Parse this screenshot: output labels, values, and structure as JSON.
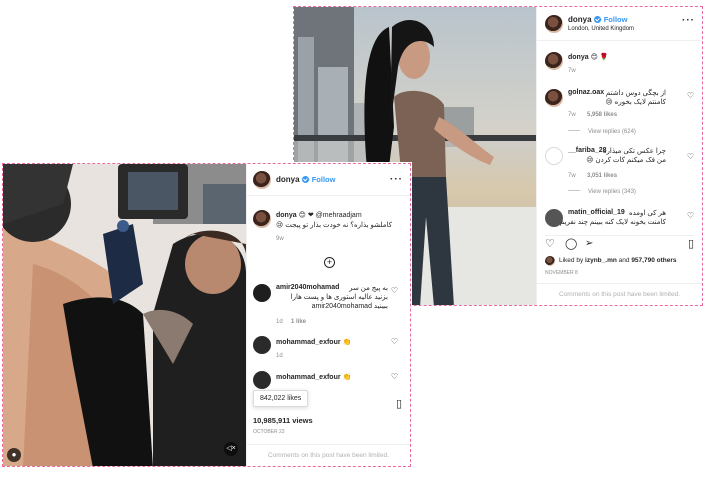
{
  "postB": {
    "username": "donya",
    "follow_label": "Follow",
    "location": "London, United Kingdom",
    "caption_user": "donya",
    "caption_emoji": "😊 🌹",
    "caption_time": "7w",
    "comments": [
      {
        "user": "golnaz.oax",
        "text_line1": "از بچگی دوس داشتم",
        "text_line2": "کامنتم لایک بخوره 😢",
        "time": "7w",
        "likes": "5,958 likes",
        "replies": "View replies (624)"
      },
      {
        "user": "__fariba_28",
        "text_line1": "چرا عکس تکی میذاره",
        "text_line2": "من فک میکنم کات کردن 😢",
        "time": "7w",
        "likes": "3,051 likes",
        "replies": "View replies (343)"
      },
      {
        "user": "matin_official_19",
        "text_line1": "هر کی اومده",
        "text_line2": "کامنت بخونه لایک کنه ببینم چند نفریم",
        "time": "",
        "likes": "",
        "replies": ""
      }
    ],
    "liked_by_prefix": "Liked by",
    "liked_by_user": "izynb_.mn",
    "liked_by_and": "and",
    "liked_by_count": "957,790 others",
    "date": "NOVEMBER 8",
    "limited_notice": "Comments on this post have been limited."
  },
  "postA": {
    "username": "donya",
    "follow_label": "Follow",
    "caption_user": "donya",
    "caption_emoji": "😊 ❤",
    "caption_mention": "@mehraadjam",
    "caption_line2": "کاملشو بذاره؟ نه خودت بذار تو پیجت 😢",
    "caption_time": "9w",
    "comments": [
      {
        "user": "amir2040mohamad",
        "text_line1": "به پیج من سر",
        "text_line2": "بزنید عالیه استوری ها و پست هارا",
        "text_line3": "ببینید amir2040mohamad",
        "time": "1d",
        "likes": "1 like"
      },
      {
        "user": "mohammad_exfour",
        "emoji": "👏",
        "time": "1d"
      },
      {
        "user": "mohammad_exfour",
        "emoji": "👏",
        "time": ""
      }
    ],
    "tooltip": "842,022 likes",
    "views": "10,985,911 views",
    "date": "OCTOBER 23",
    "limited_notice": "Comments on this post have been limited."
  },
  "colors": {
    "accent": "#3897f0",
    "dashed_border": "#e86aa0",
    "muted": "#8e8e8e"
  },
  "icons": [
    "heart-icon",
    "comment-icon",
    "share-icon",
    "bookmark-icon",
    "more-icon",
    "verified-icon",
    "add-icon",
    "user-tag-icon",
    "mute-icon"
  ]
}
